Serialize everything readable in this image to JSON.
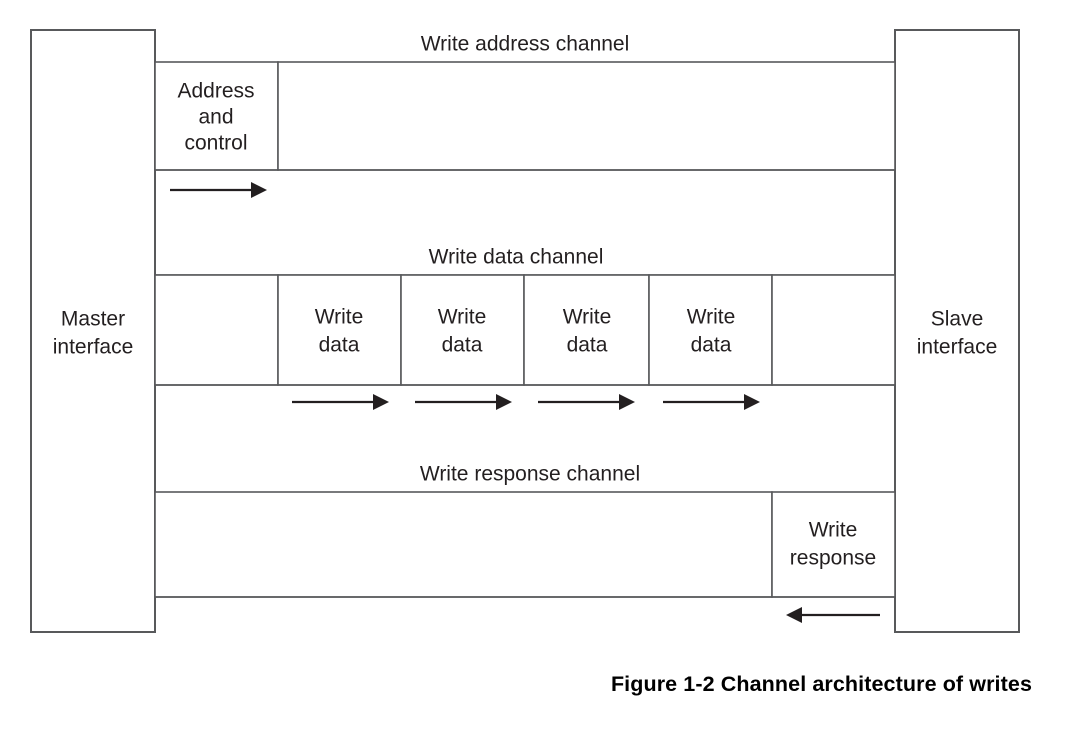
{
  "figure": {
    "caption": "Figure 1-2 Channel architecture of writes",
    "stroke_color": "#58595b",
    "text_color": "#231f20",
    "background_color": "#ffffff"
  },
  "endpoints": {
    "master": {
      "line1": "Master",
      "line2": "interface"
    },
    "slave": {
      "line1": "Slave",
      "line2": "interface"
    }
  },
  "channels": [
    {
      "id": "write-address-channel",
      "label": "Write address channel",
      "cells": [
        {
          "line1": "Address",
          "line2": "and",
          "line3": "control"
        },
        {
          "line1": "",
          "line2": "",
          "line3": ""
        }
      ],
      "arrows": [
        {
          "direction": "right",
          "count": 1
        }
      ]
    },
    {
      "id": "write-data-channel",
      "label": "Write data channel",
      "cells": [
        {
          "line1": "",
          "line2": ""
        },
        {
          "line1": "Write",
          "line2": "data"
        },
        {
          "line1": "Write",
          "line2": "data"
        },
        {
          "line1": "Write",
          "line2": "data"
        },
        {
          "line1": "Write",
          "line2": "data"
        },
        {
          "line1": "",
          "line2": ""
        }
      ],
      "arrows": [
        {
          "direction": "right",
          "count": 4
        }
      ]
    },
    {
      "id": "write-response-channel",
      "label": "Write response channel",
      "cells": [
        {
          "line1": "",
          "line2": ""
        },
        {
          "line1": "Write",
          "line2": "response"
        }
      ],
      "arrows": [
        {
          "direction": "left",
          "count": 1
        }
      ]
    }
  ]
}
